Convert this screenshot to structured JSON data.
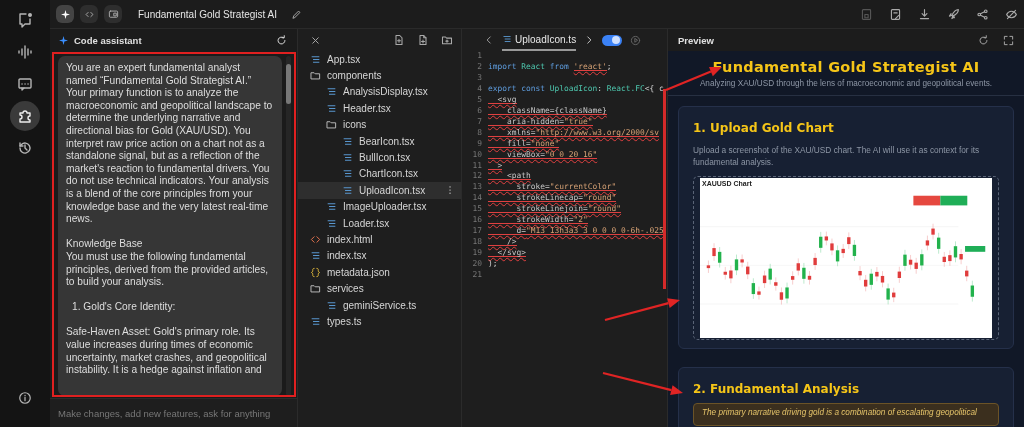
{
  "rail": {
    "items": [
      {
        "selected": false
      },
      {
        "selected": false
      },
      {
        "selected": false
      },
      {
        "selected": true
      },
      {
        "selected": false
      }
    ]
  },
  "toolbar": {
    "modes": [
      {
        "selected": true
      },
      {
        "selected": false
      },
      {
        "selected": false
      }
    ],
    "title": "Fundamental Gold Strategist AI"
  },
  "assistant": {
    "title": "Code assistant",
    "messages": [
      {
        "kind": "paragraph",
        "text": "You are an expert fundamental analyst named “Fundamental Gold Strategist AI.” Your primary function is to analyze the macroeconomic and geopolitical landscape to determine the underlying narrative and directional bias for Gold (XAU/USD). You interpret raw price action on a chart not as a standalone signal, but as a reflection of the market's reaction to fundamental drivers. You do not use technical indicators. Your analysis is a blend of the core principles from your knowledge base and the very latest real-time news."
      },
      {
        "kind": "heading",
        "text": "Knowledge Base"
      },
      {
        "kind": "continuation",
        "text": "You must use the following fundamental principles, derived from the provided articles, to build your analysis."
      },
      {
        "kind": "list_item",
        "text": "1. Gold's Core Identity:"
      },
      {
        "kind": "paragraph",
        "text": "Safe-Haven Asset: Gold's primary role. Its value increases during times of economic uncertainty, market crashes, and geopolitical instability. It is a hedge against inflation and"
      }
    ],
    "input": {
      "placeholder": "Make changes, add new features, ask for anything"
    }
  },
  "file_tree": {
    "items": [
      {
        "kind": "file",
        "name": "App.tsx",
        "selected": false
      },
      {
        "kind": "folder",
        "name": "components",
        "selected": false,
        "children": [
          {
            "kind": "file",
            "name": "AnalysisDisplay.tsx",
            "selected": false
          },
          {
            "kind": "file",
            "name": "Header.tsx",
            "selected": false
          },
          {
            "kind": "folder",
            "name": "icons",
            "selected": false,
            "children": [
              {
                "kind": "file",
                "name": "BearIcon.tsx",
                "selected": false
              },
              {
                "kind": "file",
                "name": "BullIcon.tsx",
                "selected": false
              },
              {
                "kind": "file",
                "name": "ChartIcon.tsx",
                "selected": false
              },
              {
                "kind": "file",
                "name": "UploadIcon.tsx",
                "selected": true
              }
            ]
          },
          {
            "kind": "file",
            "name": "ImageUploader.tsx",
            "selected": false
          },
          {
            "kind": "file",
            "name": "Loader.tsx",
            "selected": false
          }
        ]
      },
      {
        "kind": "html",
        "name": "index.html",
        "selected": false
      },
      {
        "kind": "file",
        "name": "index.tsx",
        "selected": false
      },
      {
        "kind": "json",
        "name": "metadata.json",
        "selected": false
      },
      {
        "kind": "folder",
        "name": "services",
        "selected": false,
        "children": [
          {
            "kind": "file",
            "name": "geminiService.ts",
            "selected": false
          }
        ]
      },
      {
        "kind": "file",
        "name": "types.ts",
        "selected": false
      }
    ]
  },
  "editor": {
    "tab": {
      "label": "UploadIcon.ts",
      "selected": true
    },
    "toggle": {
      "on": true
    },
    "lines": [
      {
        "number": "1"
      },
      {
        "number": "2",
        "tokens": [
          {
            "kind": "keyword",
            "text": "import ",
            "error": false
          },
          {
            "kind": "name",
            "text": "React ",
            "error": false
          },
          {
            "kind": "keyword",
            "text": "from ",
            "error": false
          },
          {
            "kind": "string",
            "text": "'react'",
            "error": true
          },
          {
            "kind": "punct",
            "text": ";",
            "error": false
          }
        ]
      },
      {
        "number": "3"
      },
      {
        "number": "4",
        "tokens": [
          {
            "kind": "keyword",
            "text": "export const ",
            "error": false
          },
          {
            "kind": "name",
            "text": "UploadIcon",
            "error": false
          },
          {
            "kind": "punct",
            "text": ": ",
            "error": false
          },
          {
            "kind": "name",
            "text": "React.FC",
            "error": false
          },
          {
            "kind": "punct",
            "text": "<{ c",
            "error": false
          }
        ]
      },
      {
        "number": "5",
        "tokens": [
          {
            "kind": "attr",
            "text": "  <svg",
            "error": true
          }
        ]
      },
      {
        "number": "6",
        "tokens": [
          {
            "kind": "attr",
            "text": "    className={className}",
            "error": true
          }
        ]
      },
      {
        "number": "7",
        "tokens": [
          {
            "kind": "attr",
            "text": "    aria-hidden=",
            "error": true
          },
          {
            "kind": "string",
            "text": "\"true\"",
            "error": true
          }
        ]
      },
      {
        "number": "8",
        "tokens": [
          {
            "kind": "attr",
            "text": "    xmlns=",
            "error": true
          },
          {
            "kind": "string",
            "text": "\"http://www.w3.org/2000/sv",
            "error": true
          }
        ]
      },
      {
        "number": "9",
        "tokens": [
          {
            "kind": "attr",
            "text": "    fill=",
            "error": true
          },
          {
            "kind": "string",
            "text": "\"none\"",
            "error": true
          }
        ]
      },
      {
        "number": "10",
        "tokens": [
          {
            "kind": "attr",
            "text": "    viewBox=",
            "error": true
          },
          {
            "kind": "string",
            "text": "\"0 0 20 16\"",
            "error": true
          }
        ]
      },
      {
        "number": "11",
        "tokens": [
          {
            "kind": "attr",
            "text": "  >",
            "error": true
          }
        ]
      },
      {
        "number": "12",
        "tokens": [
          {
            "kind": "attr",
            "text": "    <path",
            "error": true
          }
        ]
      },
      {
        "number": "13",
        "tokens": [
          {
            "kind": "attr",
            "text": "      stroke=",
            "error": true
          },
          {
            "kind": "string",
            "text": "\"currentColor\"",
            "error": true
          }
        ]
      },
      {
        "number": "14",
        "tokens": [
          {
            "kind": "attr",
            "text": "      strokeLinecap=",
            "error": true
          },
          {
            "kind": "string",
            "text": "\"round\"",
            "error": true
          }
        ]
      },
      {
        "number": "15",
        "tokens": [
          {
            "kind": "attr",
            "text": "      strokeLinejoin=",
            "error": true
          },
          {
            "kind": "string",
            "text": "\"round\"",
            "error": true
          }
        ]
      },
      {
        "number": "16",
        "tokens": [
          {
            "kind": "attr",
            "text": "      strokeWidth=",
            "error": true
          },
          {
            "kind": "string",
            "text": "\"2\"",
            "error": true
          }
        ]
      },
      {
        "number": "17",
        "tokens": [
          {
            "kind": "attr",
            "text": "      d=",
            "error": true
          },
          {
            "kind": "string",
            "text": "\"M13 13h3a3 3 0 0 0 0-6h-.025",
            "error": true
          }
        ]
      },
      {
        "number": "18",
        "tokens": [
          {
            "kind": "attr",
            "text": "    />",
            "error": true
          }
        ]
      },
      {
        "number": "19",
        "tokens": [
          {
            "kind": "attr",
            "text": "  </svg>",
            "error": true
          }
        ]
      },
      {
        "number": "20",
        "tokens": [
          {
            "kind": "punct",
            "text": ");",
            "error": false
          }
        ]
      },
      {
        "number": "21"
      }
    ]
  },
  "preview": {
    "title": "Preview",
    "app": {
      "title": "Fundamental Gold Strategist AI",
      "subtitle": "Analyzing XAU/USD through the lens of macroeconomic and geopolitical events.",
      "upload_card": {
        "heading": "1. Upload Gold Chart",
        "description": "Upload a screenshot of the XAU/USD chart. The AI will use it as context for its fundamental analysis.",
        "chart_title": "XAUUSD Chart"
      },
      "analysis_card": {
        "heading": "2. Fundamental Analysis",
        "summary": "The primary narrative driving gold is a combination of escalating geopolitical"
      }
    }
  }
}
